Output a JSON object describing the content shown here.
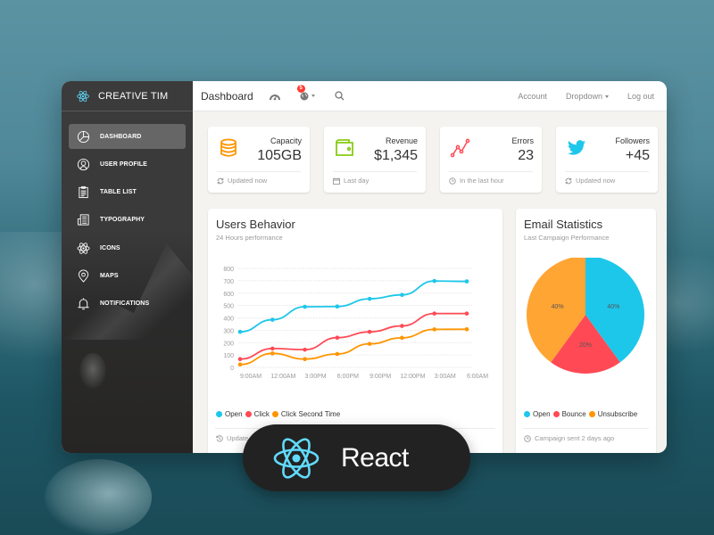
{
  "brand": {
    "name": "CREATIVE TIM",
    "logo_icon": "react-atom-icon",
    "accent": "#61dafb"
  },
  "sidebar": {
    "items": [
      {
        "label": "DASHBOARD",
        "icon": "pie-chart-icon",
        "active": true
      },
      {
        "label": "USER PROFILE",
        "icon": "user-circle-icon",
        "active": false
      },
      {
        "label": "TABLE LIST",
        "icon": "clipboard-icon",
        "active": false
      },
      {
        "label": "TYPOGRAPHY",
        "icon": "newspaper-icon",
        "active": false
      },
      {
        "label": "ICONS",
        "icon": "atom-icon",
        "active": false
      },
      {
        "label": "MAPS",
        "icon": "map-pin-icon",
        "active": false
      },
      {
        "label": "NOTIFICATIONS",
        "icon": "bell-icon",
        "active": false
      }
    ]
  },
  "topbar": {
    "title": "Dashboard",
    "icons": [
      "dashboard-gauge-icon",
      "globe-icon",
      "search-icon"
    ],
    "notification_count": "5",
    "links": {
      "account": "Account",
      "dropdown": "Dropdown",
      "logout": "Log out"
    }
  },
  "stats": [
    {
      "title": "Capacity",
      "value": "105GB",
      "footer": "Updated now",
      "icon": "database-icon",
      "footer_icon": "refresh-icon",
      "color": "#ff9500"
    },
    {
      "title": "Revenue",
      "value": "$1,345",
      "footer": "Last day",
      "icon": "wallet-icon",
      "footer_icon": "calendar-icon",
      "color": "#87cb16"
    },
    {
      "title": "Errors",
      "value": "23",
      "footer": "In the last hour",
      "icon": "graph-icon",
      "footer_icon": "clock-icon",
      "color": "#ff4a55"
    },
    {
      "title": "Followers",
      "value": "+45",
      "footer": "Updated now",
      "icon": "twitter-icon",
      "footer_icon": "refresh-icon",
      "color": "#1dc7ea"
    }
  ],
  "users_behavior": {
    "title": "Users Behavior",
    "subtitle": "24 Hours performance",
    "footer": "Updated 3 minutes ago",
    "footer_visible": "Update"
  },
  "email_stats": {
    "title": "Email Statistics",
    "subtitle": "Last Campaign Performance",
    "footer": "Campaign sent 2 days ago"
  },
  "chart_data": [
    {
      "type": "line",
      "title": "Users Behavior",
      "subtitle": "24 Hours performance",
      "x": [
        "9:00AM",
        "12:00AM",
        "3:00PM",
        "6:00PM",
        "9:00PM",
        "12:00PM",
        "3:00AM",
        "6:00AM"
      ],
      "yticks": [
        0,
        100,
        200,
        300,
        400,
        500,
        600,
        700,
        800
      ],
      "ylim": [
        0,
        800
      ],
      "grid": true,
      "legend": "bottom-left",
      "series": [
        {
          "name": "Open",
          "color": "#1dc7ea",
          "values": [
            287,
            385,
            490,
            492,
            554,
            586,
            698,
            695
          ]
        },
        {
          "name": "Click",
          "color": "#ff4a55",
          "values": [
            67,
            152,
            143,
            240,
            287,
            335,
            435,
            435
          ]
        },
        {
          "name": "Click Second Time",
          "color": "#ff9500",
          "values": [
            23,
            113,
            67,
            108,
            190,
            239,
            307,
            308
          ]
        }
      ]
    },
    {
      "type": "pie",
      "title": "Email Statistics",
      "subtitle": "Last Campaign Performance",
      "legend": "bottom-left",
      "slices": [
        {
          "name": "Open",
          "value": 40,
          "label": "40%",
          "color": "#1dc7ea"
        },
        {
          "name": "Bounce",
          "value": 20,
          "label": "20%",
          "color": "#ff4a55"
        },
        {
          "name": "Unsubscribe",
          "value": 40,
          "label": "40%",
          "color": "#ffa534"
        }
      ]
    }
  ],
  "badge": {
    "label": "React",
    "icon": "react-atom-icon"
  }
}
